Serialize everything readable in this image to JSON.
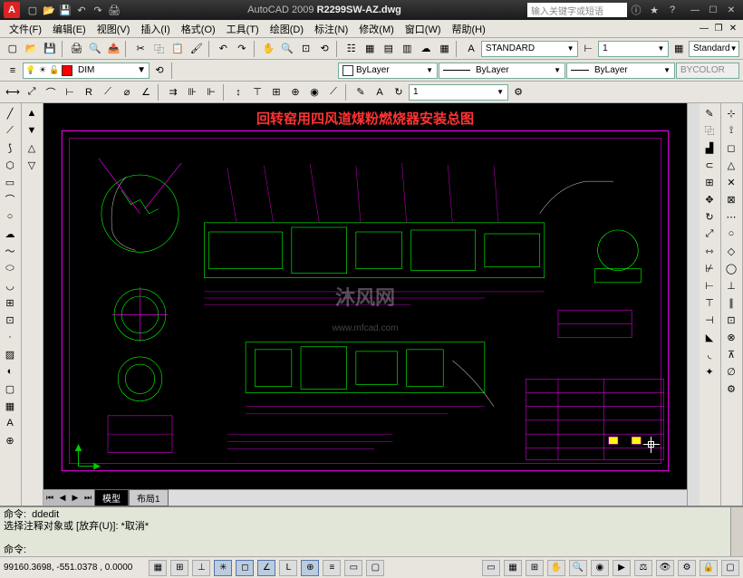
{
  "app": {
    "title_prefix": "AutoCAD 2009",
    "filename": "R2299SW-AZ.dwg",
    "search_placeholder": "输入关键字或短语"
  },
  "menu": {
    "items": [
      "文件(F)",
      "编辑(E)",
      "视图(V)",
      "插入(I)",
      "格式(O)",
      "工具(T)",
      "绘图(D)",
      "标注(N)",
      "修改(M)",
      "窗口(W)",
      "帮助(H)"
    ]
  },
  "layer": {
    "current": "DIM"
  },
  "style": {
    "text_style": "STANDARD",
    "dim_style": "1",
    "table_style": "Standard"
  },
  "props": {
    "color_label": "ByLayer",
    "ltype_label": "ByLayer",
    "lweight_label": "ByLayer",
    "plot_label": "BYCOLOR"
  },
  "tabs": {
    "model": "模型",
    "layout1": "布局1"
  },
  "drawing": {
    "title": "回转窑用四风道煤粉燃烧器安装总图",
    "watermark": "沐风网",
    "watermark_sub": "www.mfcad.com"
  },
  "cmd": {
    "line1": "命令:  ddedit",
    "line2": "选择注释对象或 [放弃(U)]: *取消*",
    "line3": " ",
    "prompt": "命令:"
  },
  "status": {
    "coords": "99160.3698, -551.0378 , 0.0000"
  }
}
